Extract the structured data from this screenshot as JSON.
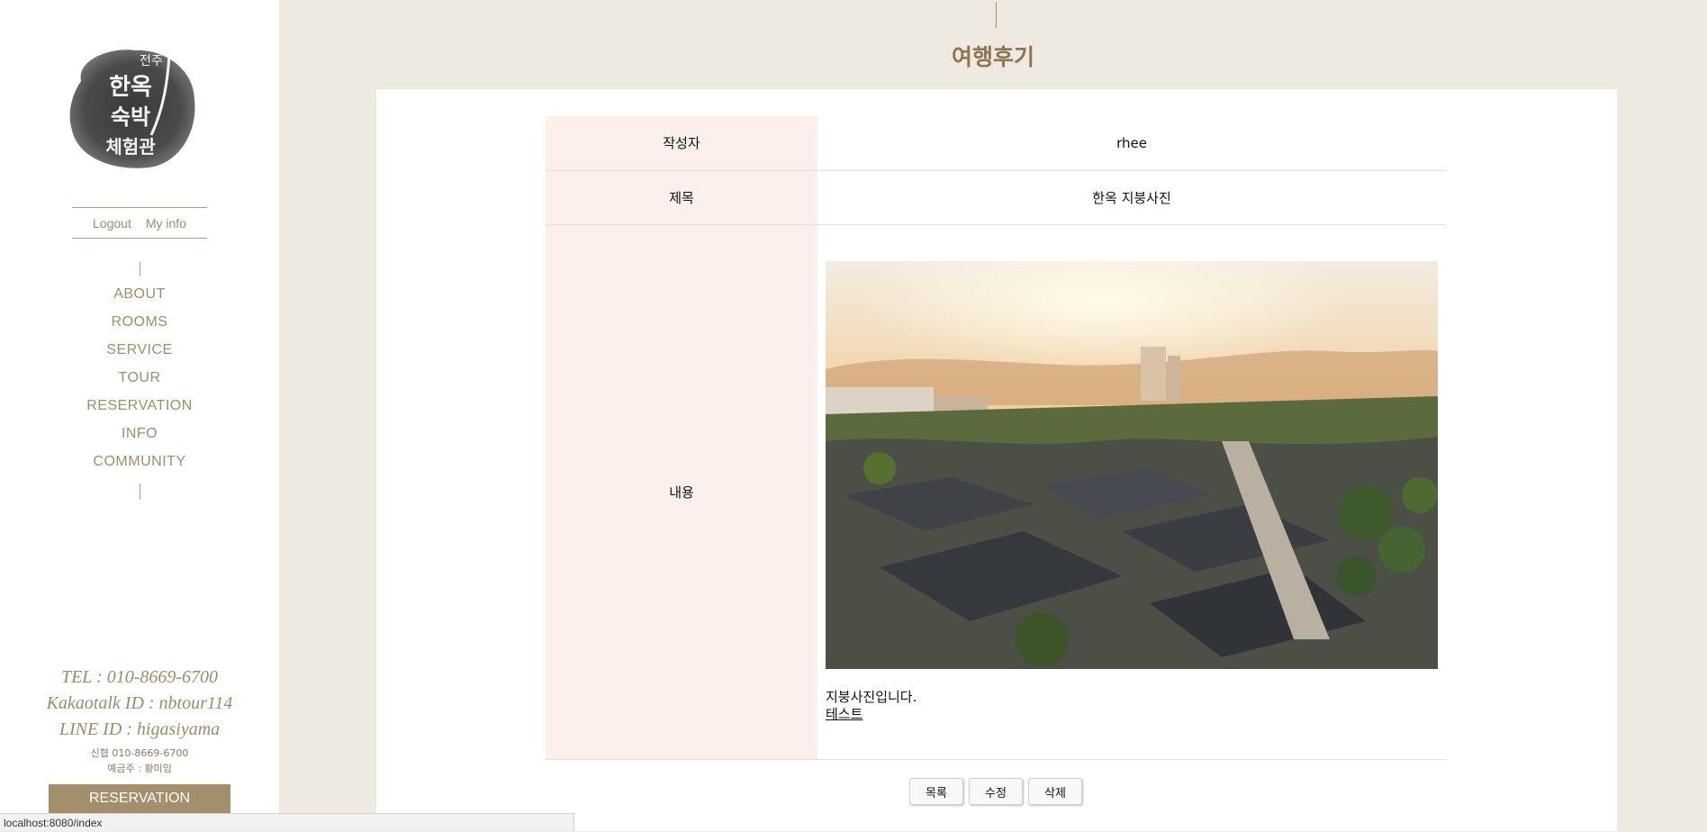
{
  "sidebar": {
    "logo_text": "전주 한옥 숙박 체험관",
    "auth": {
      "logout": "Logout",
      "myinfo": "My info"
    },
    "menu": [
      "ABOUT",
      "ROOMS",
      "SERVICE",
      "TOUR",
      "RESERVATION",
      "INFO",
      "COMMUNITY"
    ],
    "contact": {
      "tel": "TEL : 010-8669-6700",
      "kakao": "Kakaotalk ID : nbtour114",
      "line": "LINE ID : higasiyama",
      "bank": "신협 010-8669-6700",
      "holder": "예금주 : 황미임"
    },
    "reservation_button": "RESERVATION"
  },
  "status_bar": "localhost:8080/index",
  "page_title": "여행후기",
  "post": {
    "author_label": "작성자",
    "author": "rhee",
    "title_label": "제목",
    "title": "한옥 지붕사진",
    "content_label": "내용",
    "content_line1": "지붕사진입니다.",
    "content_line2": "테스트"
  },
  "buttons": {
    "list": "목록",
    "edit": "수정",
    "delete": "삭제"
  },
  "colors": {
    "accent": "#a38f6b",
    "title": "#8f7650",
    "label_bg": "#fcefec",
    "bg": "#eee9e1"
  }
}
